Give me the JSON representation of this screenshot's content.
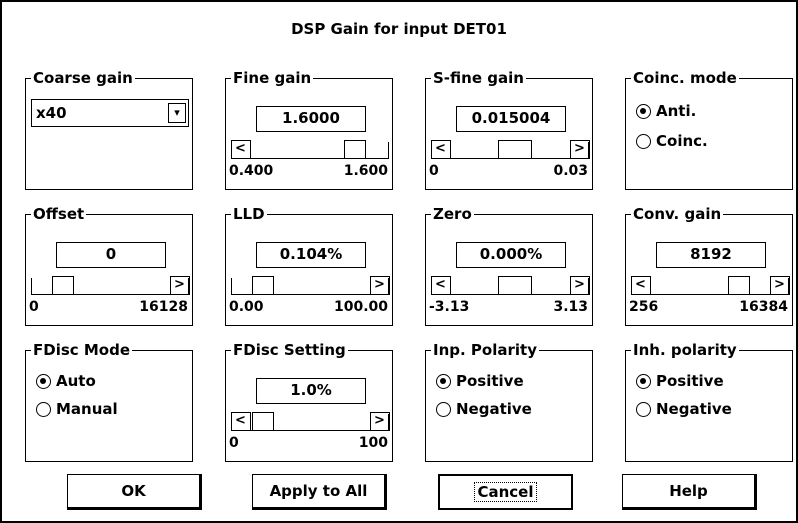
{
  "title": "DSP Gain for input DET01",
  "coarse_gain": {
    "label": "Coarse gain",
    "value": "x40",
    "dropdown_icon": "chevron-down-icon"
  },
  "fine_gain": {
    "label": "Fine gain",
    "value": "1.6000",
    "min": "0.400",
    "max": "1.600",
    "position": 1.0
  },
  "sfine_gain": {
    "label": "S-fine gain",
    "value": "0.015004",
    "min": "0",
    "max": "0.03",
    "position": 0.5
  },
  "coinc_mode": {
    "label": "Coinc. mode",
    "options": [
      "Anti.",
      "Coinc."
    ],
    "selected": 0
  },
  "offset": {
    "label": "Offset",
    "value": "0",
    "min": "0",
    "max": "16128",
    "position": 0.0
  },
  "lld": {
    "label": "LLD",
    "value": "0.104%",
    "min": "0.00",
    "max": "100.00",
    "position": 0.0
  },
  "zero": {
    "label": "Zero",
    "value": "0.000%",
    "min": "-3.13",
    "max": "3.13",
    "position": 0.5
  },
  "conv_gain": {
    "label": "Conv. gain",
    "value": "8192",
    "min": "256",
    "max": "16384",
    "position": 0.85
  },
  "fdisc_mode": {
    "label": "FDisc Mode",
    "options": [
      "Auto",
      "Manual"
    ],
    "selected": 0
  },
  "fdisc_setting": {
    "label": "FDisc Setting",
    "value": "1.0%",
    "min": "0",
    "max": "100",
    "position": 0.01
  },
  "inp_polarity": {
    "label": "Inp. Polarity",
    "options": [
      "Positive",
      "Negative"
    ],
    "selected": 0
  },
  "inh_polarity": {
    "label": "Inh. polarity",
    "options": [
      "Positive",
      "Negative"
    ],
    "selected": 0
  },
  "buttons": {
    "ok": "OK",
    "apply_all": "Apply to All",
    "cancel": "Cancel",
    "help": "Help"
  }
}
